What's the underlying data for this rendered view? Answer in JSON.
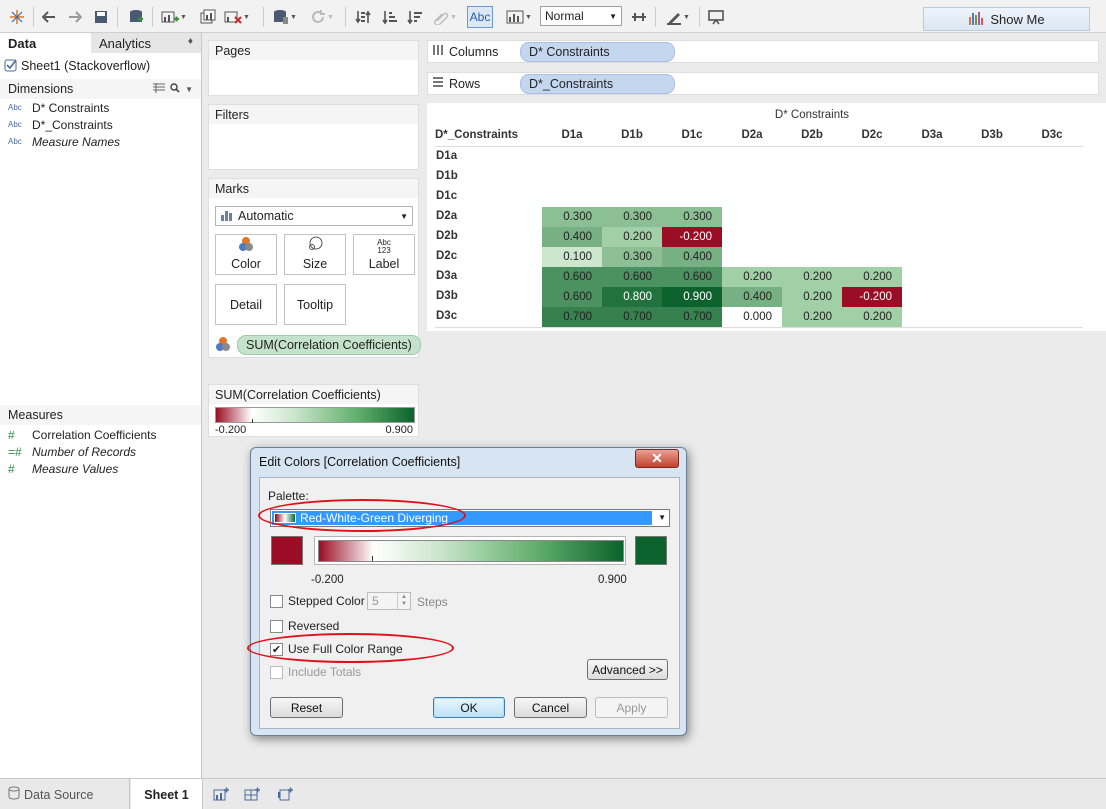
{
  "toolbar": {
    "fit_value": "Normal",
    "show_me": "Show Me",
    "abc_label": "Abc"
  },
  "left_pane": {
    "tab_data": "Data",
    "tab_analytics": "Analytics",
    "datasource": "Sheet1 (Stackoverflow)",
    "dimensions_label": "Dimensions",
    "dimensions": [
      {
        "type": "Abc",
        "name": "D* Constraints",
        "italic": false
      },
      {
        "type": "Abc",
        "name": "D*_Constraints",
        "italic": false
      },
      {
        "type": "Abc",
        "name": "Measure Names",
        "italic": true
      }
    ],
    "measures_label": "Measures",
    "measures": [
      {
        "type": "#",
        "name": "Correlation Coefficients",
        "italic": false
      },
      {
        "type": "=#",
        "name": "Number of Records",
        "italic": true
      },
      {
        "type": "#",
        "name": "Measure Values",
        "italic": true
      }
    ]
  },
  "bottom": {
    "data_source": "Data Source",
    "sheet": "Sheet 1"
  },
  "cards": {
    "pages": "Pages",
    "filters": "Filters",
    "marks": "Marks",
    "marks_type": "Automatic",
    "mark_buttons": {
      "color": "Color",
      "size": "Size",
      "label": "Label",
      "detail": "Detail",
      "tooltip": "Tooltip"
    },
    "label_icon_top": "Abc",
    "label_icon_bottom": "123",
    "color_pill": "SUM(Correlation Coefficients)"
  },
  "shelves": {
    "columns_label": "Columns",
    "columns_pill": "D* Constraints",
    "rows_label": "Rows",
    "rows_pill": "D*_Constraints"
  },
  "legend": {
    "title": "SUM(Correlation Coefficients)",
    "min": "-0.200",
    "max": "0.900"
  },
  "viz": {
    "column_title": "D* Constraints",
    "row_title": "D*_Constraints",
    "columns": [
      "D1a",
      "D1b",
      "D1c",
      "D2a",
      "D2b",
      "D2c",
      "D3a",
      "D3b",
      "D3c"
    ],
    "rows": [
      "D1a",
      "D1b",
      "D1c",
      "D2a",
      "D2b",
      "D2c",
      "D3a",
      "D3b",
      "D3c"
    ],
    "cells": [
      [
        null,
        null,
        null,
        null,
        null,
        null
      ],
      [
        null,
        null,
        null,
        null,
        null,
        null
      ],
      [
        null,
        null,
        null,
        null,
        null,
        null
      ],
      [
        "0.300",
        "0.300",
        "0.300",
        null,
        null,
        null
      ],
      [
        "0.400",
        "0.200",
        "-0.200",
        null,
        null,
        null
      ],
      [
        "0.100",
        "0.300",
        "0.400",
        null,
        null,
        null
      ],
      [
        "0.600",
        "0.600",
        "0.600",
        "0.200",
        "0.200",
        "0.200"
      ],
      [
        "0.600",
        "0.800",
        "0.900",
        "0.400",
        "0.200",
        "-0.200"
      ],
      [
        "0.700",
        "0.700",
        "0.700",
        "0.000",
        "0.200",
        "0.200"
      ]
    ]
  },
  "dialog": {
    "title": "Edit Colors [Correlation Coefficients]",
    "palette_label": "Palette:",
    "palette_value": "Red-White-Green Diverging",
    "min": "-0.200",
    "max": "0.900",
    "stepped_color": "Stepped Color",
    "steps_value": "5",
    "steps_label": "Steps",
    "reversed": "Reversed",
    "use_full_range": "Use Full Color Range",
    "include_totals": "Include Totals",
    "advanced": "Advanced >>",
    "reset": "Reset",
    "ok": "OK",
    "cancel": "Cancel",
    "apply": "Apply",
    "stepped_checked": false,
    "reversed_checked": false,
    "full_range_checked": true,
    "include_totals_checked": false
  },
  "colors": {
    "negative": "#9b0d24",
    "positive": "#0c622c",
    "selection": "#3399ff",
    "annotation": "#e0101a"
  }
}
